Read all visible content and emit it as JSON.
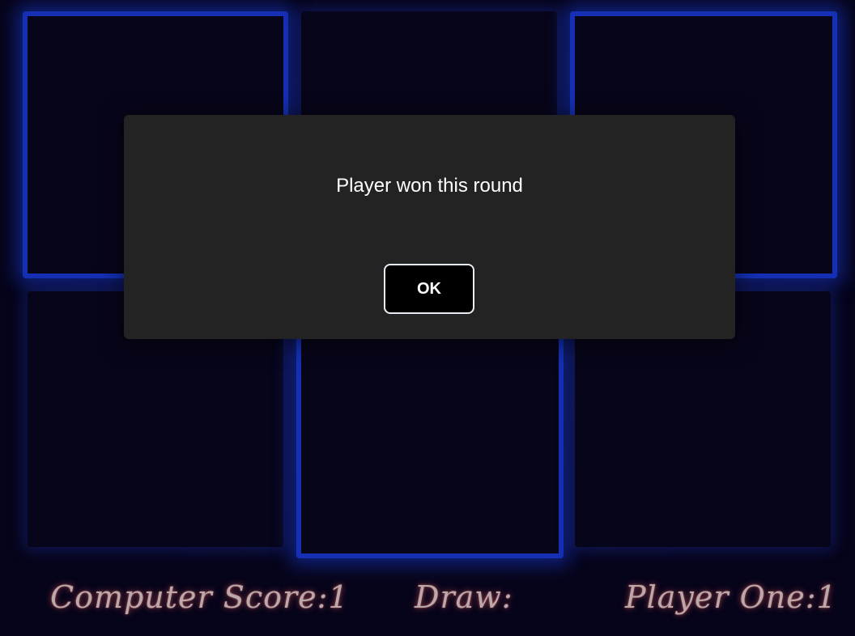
{
  "board": {
    "cells": [
      {
        "highlighted": true
      },
      {
        "highlighted": false
      },
      {
        "highlighted": true
      },
      {
        "highlighted": false
      },
      {
        "highlighted": true
      },
      {
        "highlighted": false
      }
    ]
  },
  "scoreboard": {
    "computer_label": "Computer Score:",
    "computer_value": "1",
    "draw_label": "Draw:",
    "draw_value": "",
    "player_label": "Player One:",
    "player_value": "1"
  },
  "dialog": {
    "message": "Player won this round",
    "ok_label": "OK"
  },
  "colors": {
    "background": "#06041a",
    "highlight_border": "#1530b4",
    "dialog_background": "#232323",
    "score_text": "#b9a9aa"
  }
}
